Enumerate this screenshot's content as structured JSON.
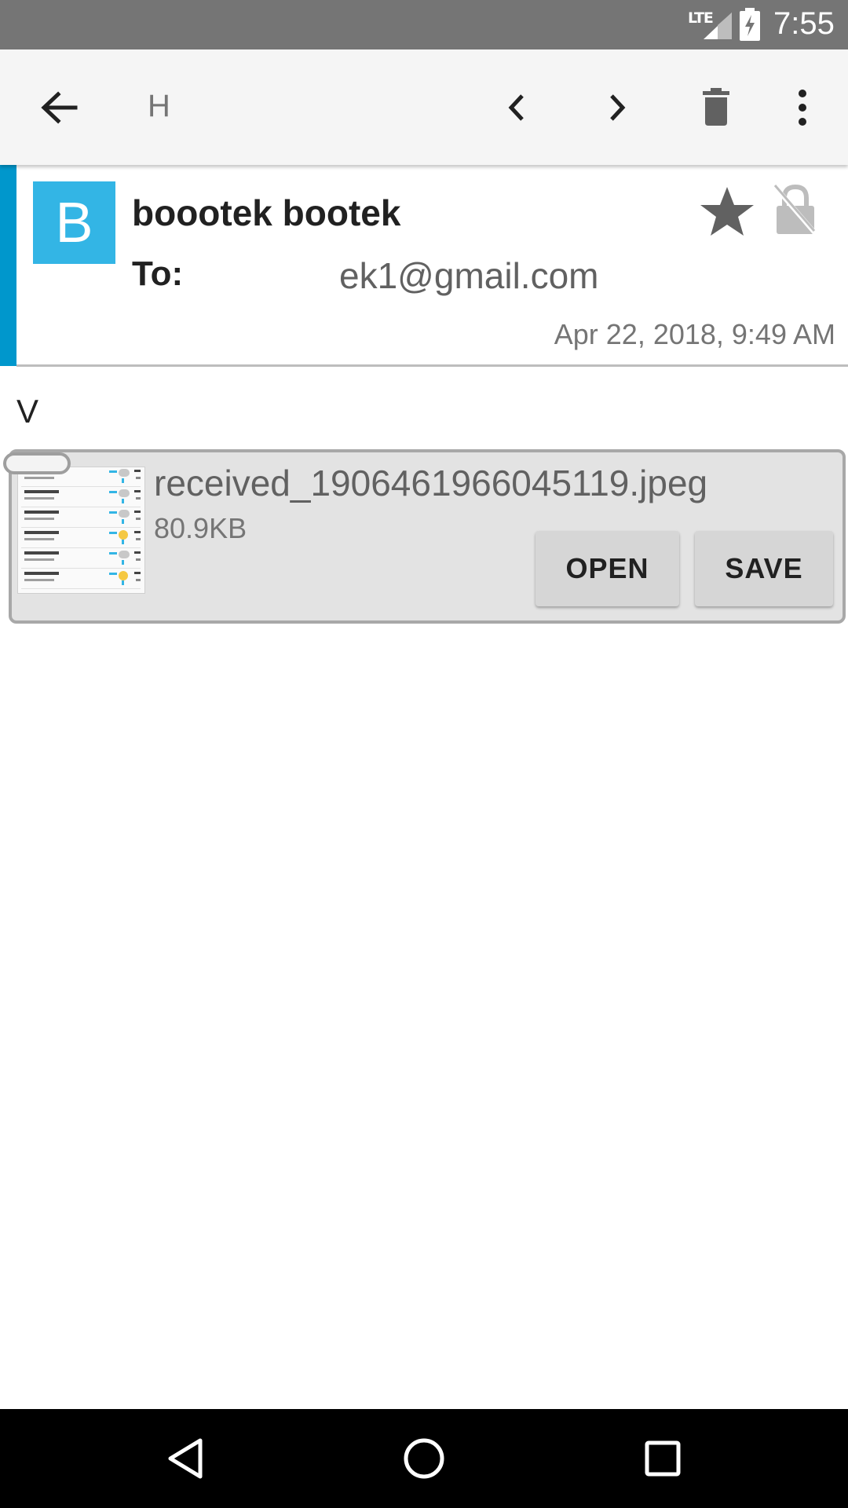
{
  "status_bar": {
    "network": "LTE",
    "time": "7:55",
    "icons": [
      "lte-signal-icon",
      "battery-charging-icon"
    ]
  },
  "toolbar": {
    "title": "H",
    "icons": [
      "back-arrow-icon",
      "chevron-left-icon",
      "chevron-right-icon",
      "trash-icon",
      "overflow-menu-icon"
    ]
  },
  "message": {
    "avatar_letter": "B",
    "sender": "boootek bootek",
    "to_label": "To:",
    "to_value": "ek1@gmail.com",
    "date": "Apr 22, 2018, 9:49 AM",
    "body": "V"
  },
  "attachment": {
    "filename": "received_1906461966045119.jpeg",
    "size": "80.9KB",
    "open_label": "OPEN",
    "save_label": "SAVE"
  },
  "colors": {
    "accent": "#0097cc",
    "avatar": "#33b5e5",
    "status_bar": "#757575"
  }
}
